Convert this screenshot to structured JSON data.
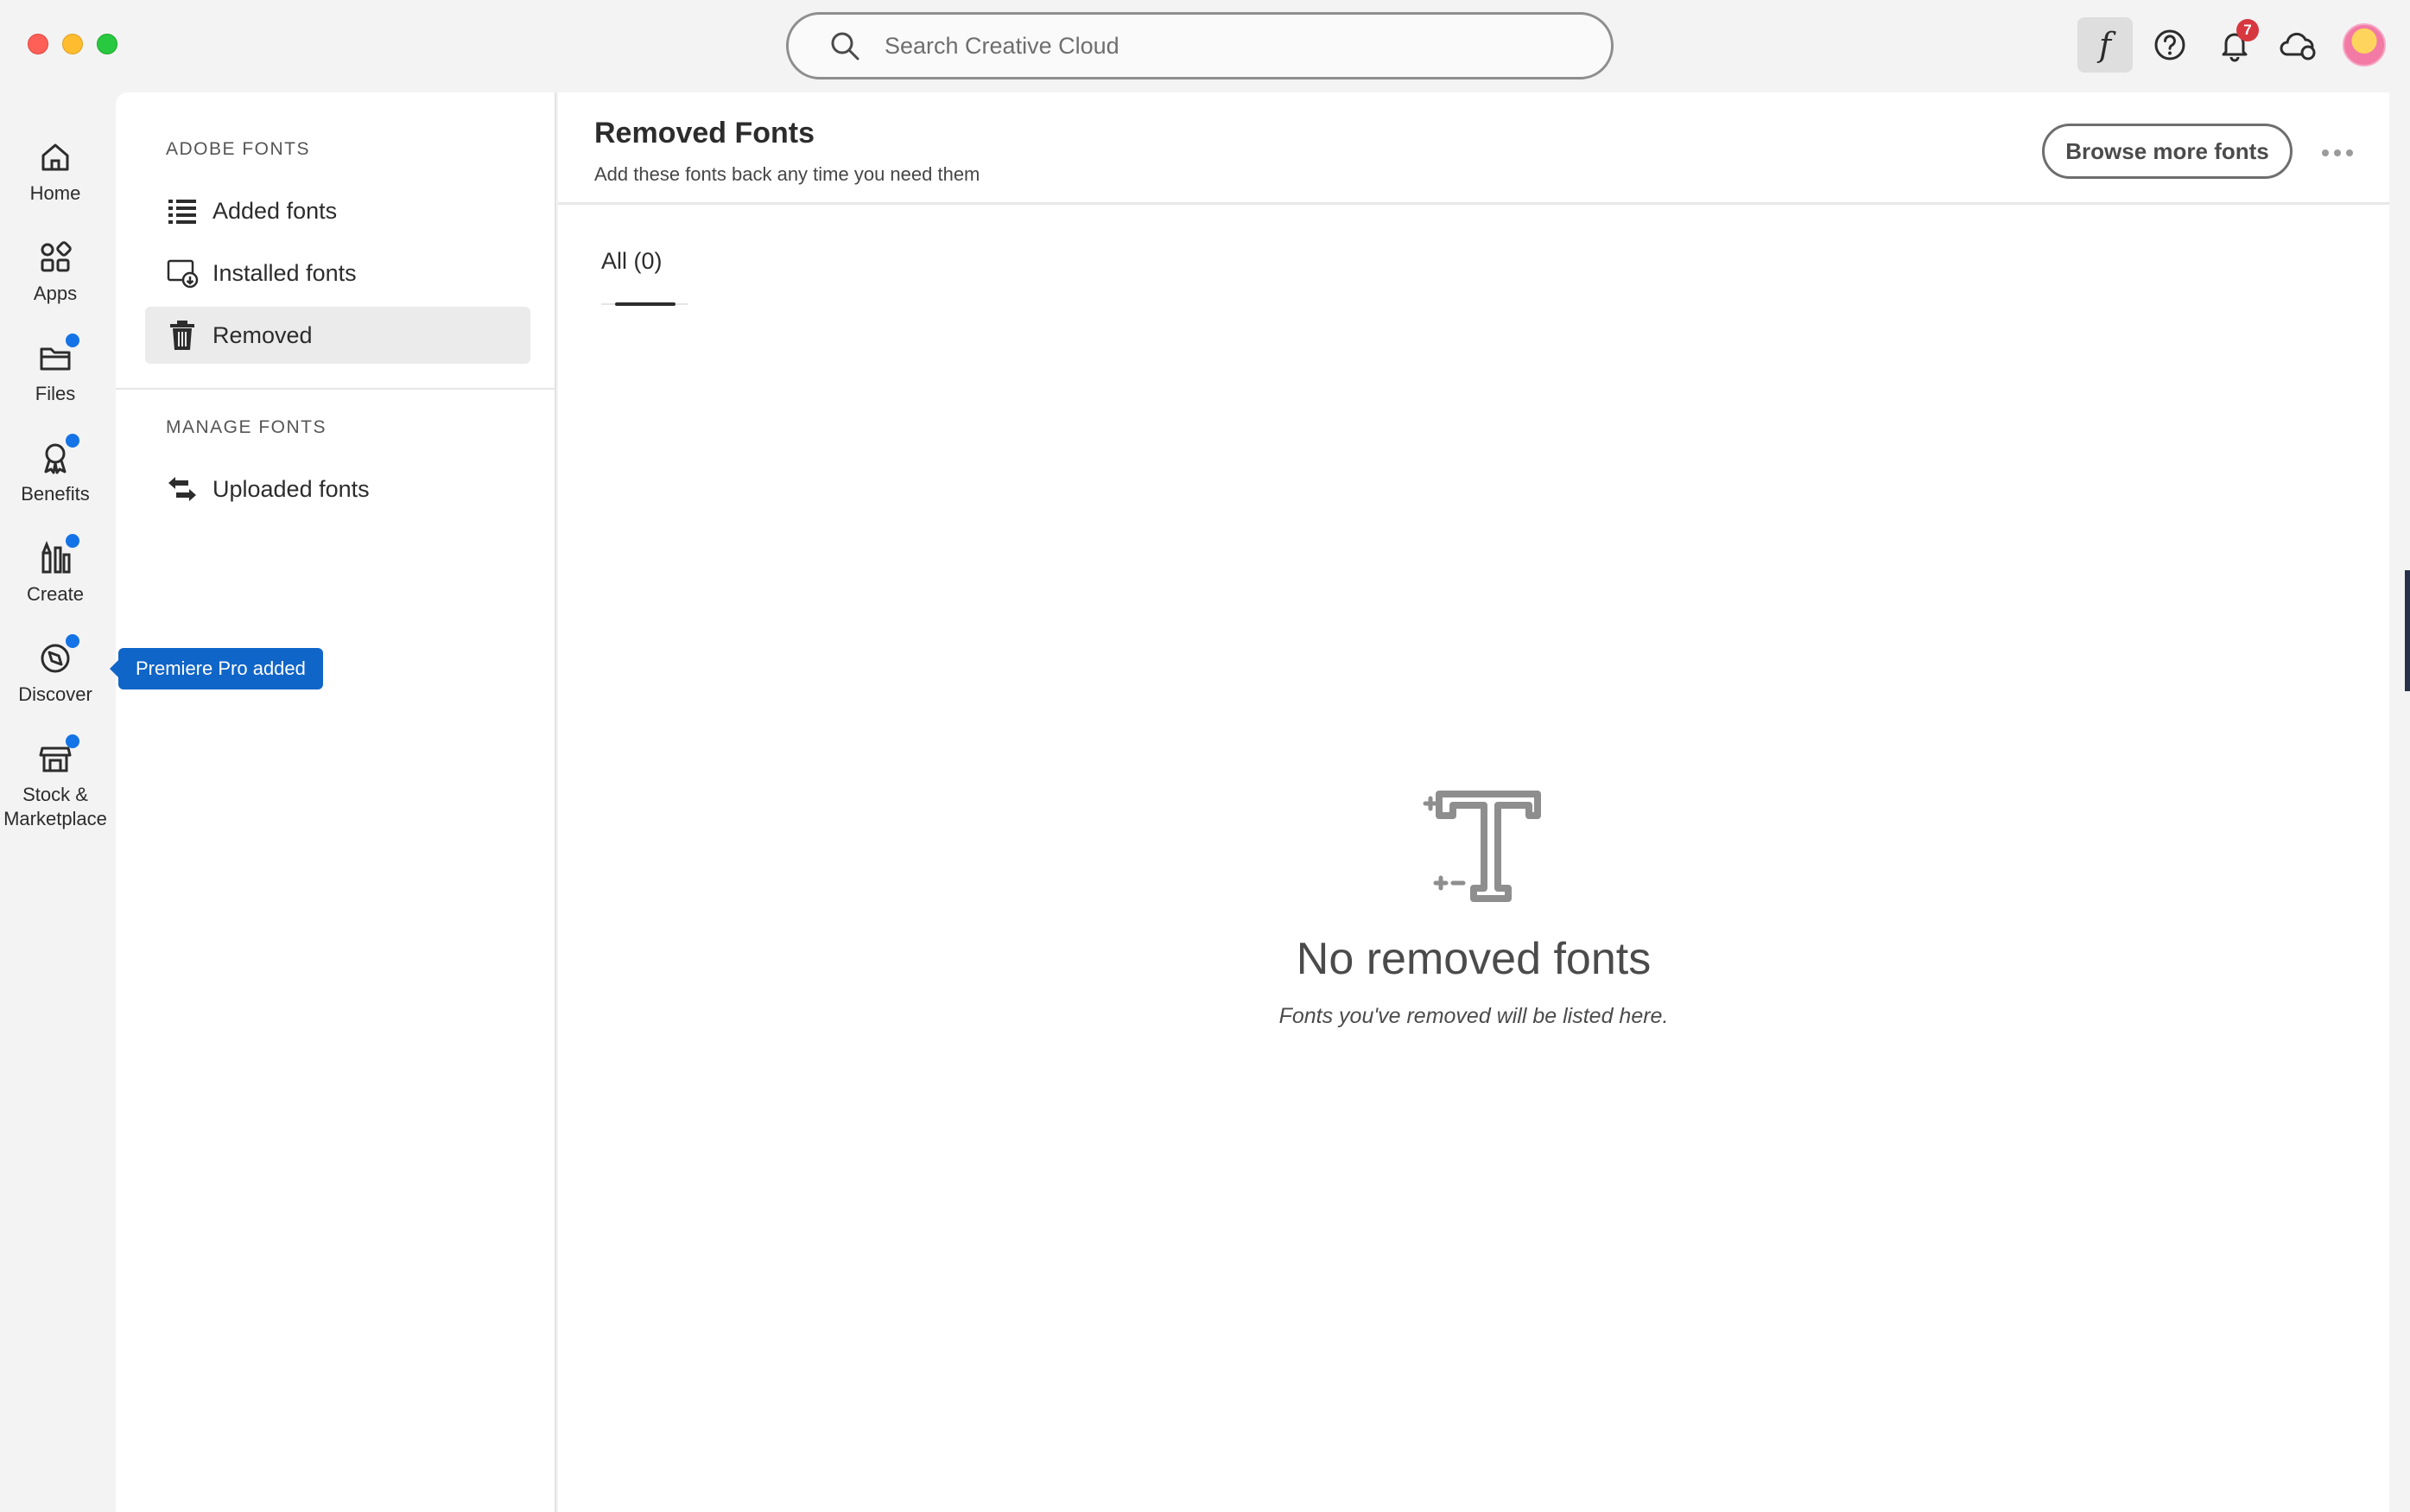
{
  "window": {
    "title": "Creative Cloud"
  },
  "search": {
    "placeholder": "Search Creative Cloud"
  },
  "topbar": {
    "fonts_icon": "italic-f-icon",
    "help_icon": "help-circle-icon",
    "notifications_icon": "bell-icon",
    "notifications_count": "7",
    "cloud_icon": "cloud-sync-icon",
    "avatar_icon": "user-avatar"
  },
  "rail": {
    "items": [
      {
        "label": "Home",
        "icon": "home-icon",
        "dot": false
      },
      {
        "label": "Apps",
        "icon": "apps-grid-icon",
        "dot": false
      },
      {
        "label": "Files",
        "icon": "folder-icon",
        "dot": true
      },
      {
        "label": "Benefits",
        "icon": "ribbon-icon",
        "dot": true
      },
      {
        "label": "Create",
        "icon": "create-tools-icon",
        "dot": true
      },
      {
        "label": "Discover",
        "icon": "compass-icon",
        "dot": true
      },
      {
        "label": "Stock &",
        "label2": "Marketplace",
        "icon": "storefront-icon",
        "dot": true
      }
    ],
    "accent_dot_color": "#1473e6"
  },
  "tooltip": {
    "text": "Premiere Pro added"
  },
  "sidebar": {
    "section1": "ADOBE FONTS",
    "section2": "MANAGE FONTS",
    "items": [
      {
        "label": "Added fonts",
        "icon": "list-icon"
      },
      {
        "label": "Installed fonts",
        "icon": "installed-font-icon"
      },
      {
        "label": "Removed",
        "icon": "trash-icon",
        "active": true
      },
      {
        "label": "Uploaded fonts",
        "icon": "swap-arrows-icon"
      }
    ]
  },
  "main": {
    "title": "Removed Fonts",
    "subtitle": "Add these fonts back any time you need them",
    "browse_button": "Browse more fonts",
    "tabs": [
      {
        "label": "All (0)",
        "active": true
      }
    ],
    "empty": {
      "icon": "font-t-sparkle-icon",
      "title": "No removed fonts",
      "subtitle": "Fonts you've removed will be listed here."
    }
  }
}
